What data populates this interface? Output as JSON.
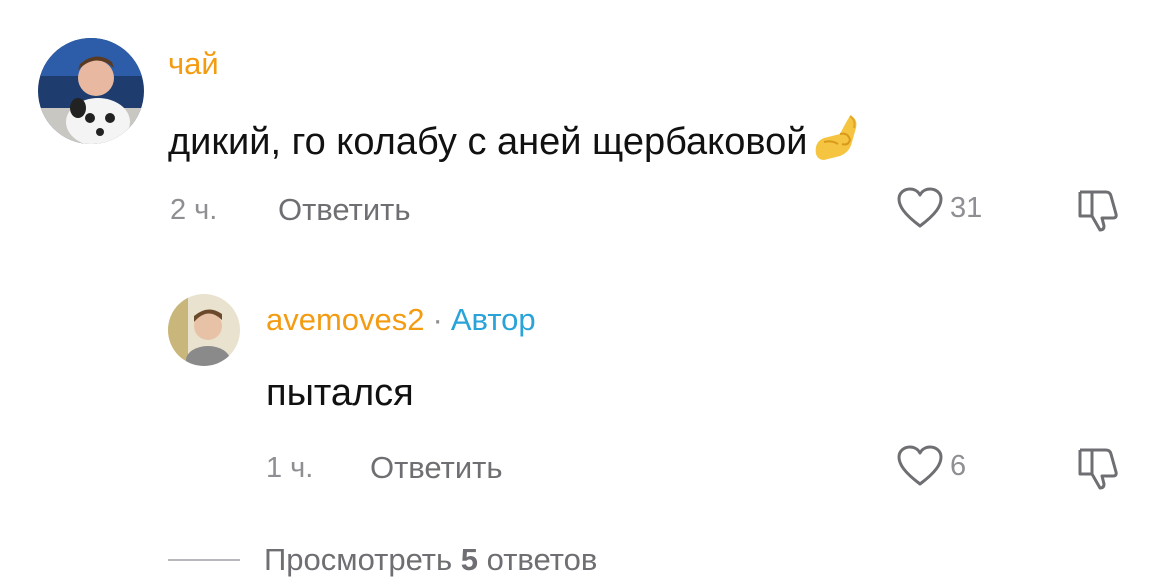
{
  "comments": [
    {
      "username": "чай",
      "text": "дикий, го колабу с аней щербаковой",
      "emoji": "pinched-fingers-emoji",
      "time": "2 ч.",
      "reply_label": "Ответить",
      "likes": "31"
    }
  ],
  "reply": {
    "username": "avemoves2",
    "separator": "·",
    "badge": "Автор",
    "text": "пытался",
    "time": "1 ч.",
    "reply_label": "Ответить",
    "likes": "6"
  },
  "view_replies": {
    "prefix": "Просмотреть",
    "count": "5",
    "suffix": "ответов"
  },
  "colors": {
    "username": "#f39c12",
    "author_badge": "#2aa3d9",
    "text": "#111111",
    "muted": "#8e8e93"
  },
  "icons": [
    "heart-icon",
    "dislike-icon",
    "pinched-fingers-emoji"
  ]
}
